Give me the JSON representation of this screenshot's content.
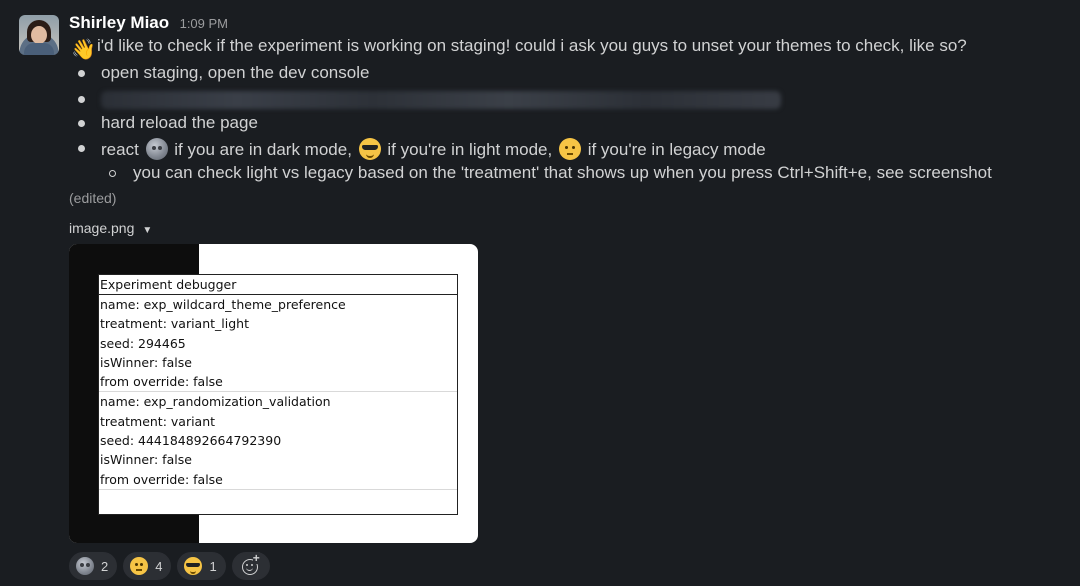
{
  "message": {
    "author": "Shirley Miao",
    "time": "1:09 PM",
    "intro": "i'd like to check if the experiment is working on staging! could i ask you guys to unset your themes to check, like so?",
    "bullets": {
      "b1": "open staging, open the dev console",
      "b3": "hard reload the page",
      "b4_prefix": "react",
      "b4_dark": "if you are in dark mode,",
      "b4_light": "if you're in light mode,",
      "b4_legacy": "if you're in legacy mode",
      "sub1": "you can check light vs legacy based on the 'treatment' that shows up when you press Ctrl+Shift+e, see screenshot"
    },
    "edited": "(edited)",
    "attachment_name": "image.png",
    "icons": {
      "wave": "waving-hand-icon",
      "dark": "new-moon-face-icon",
      "light": "sunglasses-face-icon",
      "legacy": "older-person-face-icon"
    }
  },
  "debugger": {
    "title": "Experiment debugger",
    "experiments": [
      {
        "name": "name: exp_wildcard_theme_preference",
        "treatment": "treatment: variant_light",
        "seed": "seed: 294465",
        "isWinner": "isWinner: false",
        "override": "from override: false"
      },
      {
        "name": "name: exp_randomization_validation",
        "treatment": "treatment: variant",
        "seed": "seed: 444184892664792390",
        "isWinner": "isWinner: false",
        "override": "from override: false"
      }
    ]
  },
  "reactions": [
    {
      "icon": "new-moon-face-icon",
      "count": "2"
    },
    {
      "icon": "older-person-face-icon",
      "count": "4"
    },
    {
      "icon": "sunglasses-face-icon",
      "count": "1"
    }
  ],
  "colors": {
    "background": "#1a1d21",
    "text": "#d1d2d3",
    "muted": "#9b9c9e",
    "reaction_pill": "#2c2f34"
  }
}
